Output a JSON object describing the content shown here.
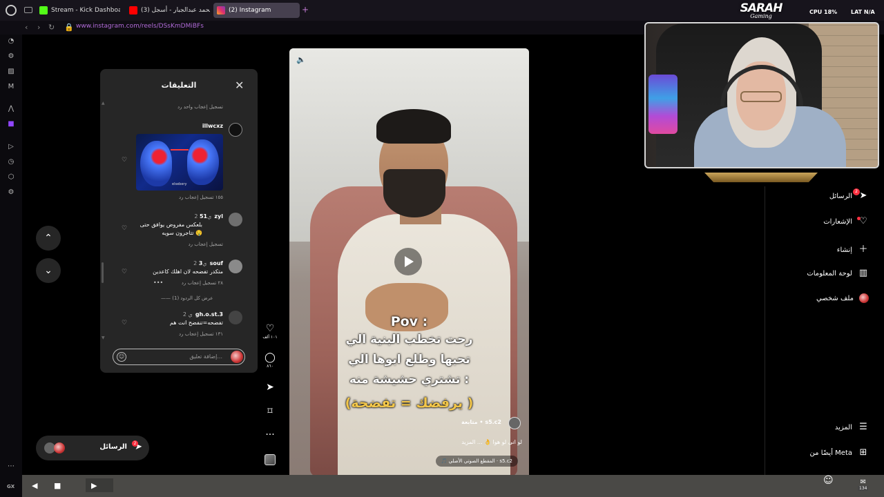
{
  "browser": {
    "tabs": [
      {
        "label": "Stream - Kick Dashboard",
        "active": false
      },
      {
        "label": "(3) محمد عبدالجبار - أسجل ...",
        "active": false
      },
      {
        "label": "(2) Instagram",
        "active": true
      }
    ],
    "url": "www.instagram.com/reels/DSsKmDMiBFs"
  },
  "comments_panel": {
    "title": "التعليقات",
    "prev_actions": "تسجيل إعجاب واحد   رد",
    "comments": [
      {
        "user": "illwcxz",
        "gif_watermark": "elsebery",
        "actions": "١٥٥ تسجيل إعجاب   رد"
      },
      {
        "user": "51zyl",
        "time": "2 ي",
        "text_line1": "بلعكس مفروض يوافق حتى",
        "text_line2": "تتاجرون سويه 🤤",
        "actions": "تسجيل إعجاب   رد"
      },
      {
        "user": "3souf",
        "time": "2 ي",
        "text": "متكدر تفضحه لان اهلك كاعدين",
        "actions": "٢٨ تسجيل إعجاب   رد",
        "more": "•••",
        "view_replies": "عرض كل الردود (1)"
      },
      {
        "user": "gh.o.st.3",
        "time": "2 ي",
        "text": "تفضحه=تنفضح انت هم",
        "actions": "١٣١ تسجيل إعجاب   رد"
      }
    ],
    "input_placeholder": "إضافة تعليق..."
  },
  "video": {
    "captions": [
      "Pov :",
      "رحت تخطب البنية الي",
      "تحبها وطلع ابوها الي",
      "تشتري حشيشة منه :",
      "(يرفضك = تفضحة )"
    ],
    "username": "s5.c2",
    "follow_label": "متابعة",
    "description": "لو انى لو هوا 👌 ... المزيد",
    "audio": "🎵 المقطع الصوتي الأصلي · s5.c2"
  },
  "actions": {
    "likes": "١٠١ ألف",
    "comments": "٨٦٠"
  },
  "right_nav": {
    "messages": "الرسائل",
    "messages_badge": "2",
    "notifications": "الإشعارات",
    "create": "إنشاء",
    "dashboard": "لوحة المعلومات",
    "profile": "ملف شخصي",
    "more": "المزيد",
    "also_meta": "أيضًا من Meta"
  },
  "messages_pill": {
    "label": "الرسائل",
    "badge": "2"
  },
  "overlay": {
    "logo_title": "SARAH",
    "logo_sub": "Gaming",
    "cpu": "CPU 18%",
    "lat": "LAT N/A"
  },
  "bottom_bar": {
    "mail_count": "134"
  },
  "sidebar_bottom": "GX"
}
